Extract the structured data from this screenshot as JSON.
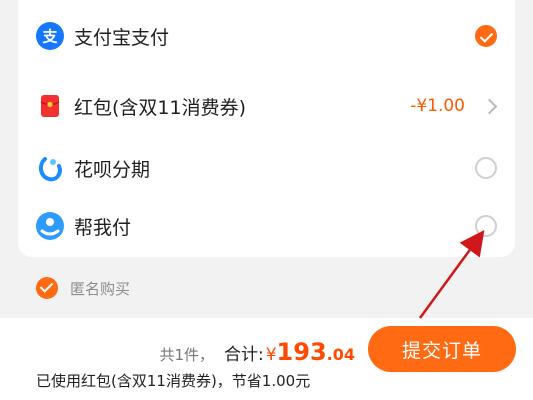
{
  "payment": {
    "options": [
      {
        "label": "支付宝支付",
        "icon": "alipay-icon",
        "selected": true
      },
      {
        "label": "红包(含双11消费券)",
        "icon": "red-envelope-icon",
        "amount": "-¥1.00"
      },
      {
        "label": "花呗分期",
        "icon": "huabei-icon",
        "selected": false
      },
      {
        "label": "帮我付",
        "icon": "help-me-pay-icon",
        "selected": false
      }
    ]
  },
  "anonymous": {
    "label": "匿名购买",
    "checked": true
  },
  "footer": {
    "count": "共1件，",
    "total_label": "合计:",
    "currency": "¥",
    "total_int": "193",
    "total_dec": ".04",
    "submit_label": "提交订单",
    "saving_note": "已使用红包(含双11消费券)，节省1.00元"
  },
  "colors": {
    "accent": "#ff6a13",
    "price": "#ff4a00",
    "alipay": "#1677ff",
    "arrow": "#d0181b"
  }
}
